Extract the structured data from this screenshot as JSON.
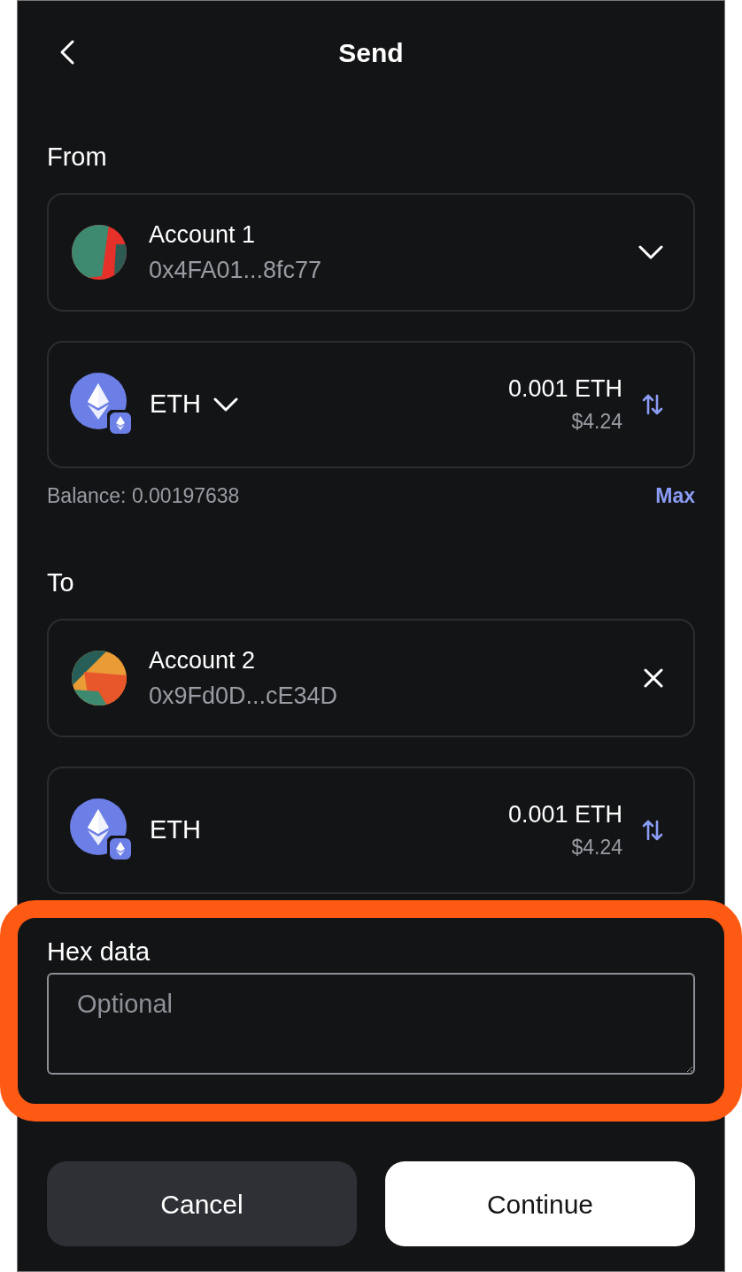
{
  "header": {
    "title": "Send"
  },
  "from": {
    "label": "From",
    "account": {
      "name": "Account 1",
      "address": "0x4FA01...8fc77",
      "kind": "dropdown"
    },
    "asset": {
      "symbol": "ETH",
      "selectable": true,
      "amount": "0.001 ETH",
      "fiat": "$4.24"
    },
    "balance": "Balance: 0.00197638",
    "max_link": "Max"
  },
  "to": {
    "label": "To",
    "account": {
      "name": "Account 2",
      "address": "0x9Fd0D...cE34D",
      "kind": "clear"
    },
    "asset": {
      "symbol": "ETH",
      "selectable": false,
      "amount": "0.001 ETH",
      "fiat": "$4.24"
    }
  },
  "hex_data": {
    "label": "Hex data",
    "placeholder": "Optional",
    "highlighted": true
  },
  "buttons": [
    {
      "label": "Cancel",
      "kind": "secondary"
    },
    {
      "label": "Continue",
      "kind": "primary"
    }
  ]
}
